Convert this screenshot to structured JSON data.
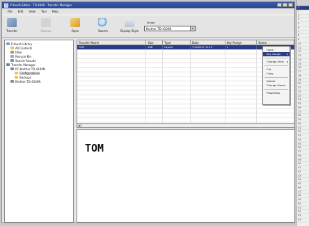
{
  "window": {
    "title": "P-touch Editor - TD-4000 - Transfer Manager"
  },
  "menu": [
    "File",
    "Edit",
    "View",
    "Tool",
    "Help"
  ],
  "toolbar": {
    "buttons": [
      {
        "label": "Transfer",
        "icon": "transfer-icon"
      },
      {
        "label": "Backup",
        "icon": "backup-icon"
      },
      {
        "label": "Open",
        "icon": "open-folder-icon"
      },
      {
        "label": "Search",
        "icon": "search-icon"
      },
      {
        "label": "Display Style",
        "icon": "display-style-icon"
      }
    ],
    "printer_label": "Printer",
    "printer_value": "Brother TD-4100N"
  },
  "tree": [
    {
      "label": "P-touch Library",
      "indent": 0,
      "icon": "library-icon"
    },
    {
      "label": "All Contents",
      "indent": 1,
      "icon": "folder-icon"
    },
    {
      "label": "Filter",
      "indent": 1,
      "icon": "filter-icon"
    },
    {
      "label": "Recycle Bin",
      "indent": 1,
      "icon": "recycle-bin-icon"
    },
    {
      "label": "Search Results",
      "indent": 1,
      "icon": "search-icon"
    },
    {
      "label": "Transfer Manager",
      "indent": 0,
      "icon": "transfer-manager-icon"
    },
    {
      "label": "PC-Brother TD-4100N",
      "indent": 1,
      "icon": "pc-icon"
    },
    {
      "label": "Configurations",
      "indent": 2,
      "icon": "folder-icon",
      "selected": true
    },
    {
      "label": "Backups",
      "indent": 2,
      "icon": "folder-icon"
    },
    {
      "label": "Brother TD-4100N",
      "indent": 1,
      "icon": "printer-icon"
    }
  ],
  "grid": {
    "columns": [
      "Transfer Name",
      "Size",
      "Type",
      "Date",
      "Key Assign",
      "Name"
    ],
    "rows": [
      [
        "TOM",
        "1KB",
        "Layout",
        "7/10/2017 11:19",
        "1",
        ""
      ]
    ],
    "empty_rows": 20
  },
  "context_menu": {
    "items": [
      {
        "label": "Open"
      },
      {
        "label": "Key Assign",
        "active": true,
        "submenu": true
      },
      {
        "sep": true
      },
      {
        "label": "Change View",
        "submenu": true
      },
      {
        "sep": true
      },
      {
        "label": "Cut"
      },
      {
        "label": "Copy"
      },
      {
        "sep": true
      },
      {
        "label": "Delete"
      },
      {
        "label": "Change Name"
      },
      {
        "sep": true
      },
      {
        "label": "Properties"
      }
    ]
  },
  "preview": {
    "text": "TOM"
  },
  "ruler": {
    "numbers": [
      "1",
      "2",
      "3",
      "4",
      "5",
      "6",
      "7",
      "8",
      "9",
      "10",
      "11",
      "12",
      "13",
      "14",
      "15",
      "16",
      "17",
      "18",
      "19",
      "20",
      "21",
      "22",
      "23",
      "24",
      "25",
      "26",
      "27",
      "28",
      "29",
      "30",
      "31",
      "32",
      "33",
      "34",
      "35",
      "36",
      "37",
      "38",
      "39",
      "40",
      "41",
      "42",
      "43",
      "44",
      "45",
      "46",
      "47",
      "48",
      "49",
      "50",
      "51",
      "52",
      "53",
      "54"
    ],
    "highlight_index": 0
  },
  "colors": {
    "selection": "#2a3c86",
    "title_bar": "#2a478f"
  }
}
